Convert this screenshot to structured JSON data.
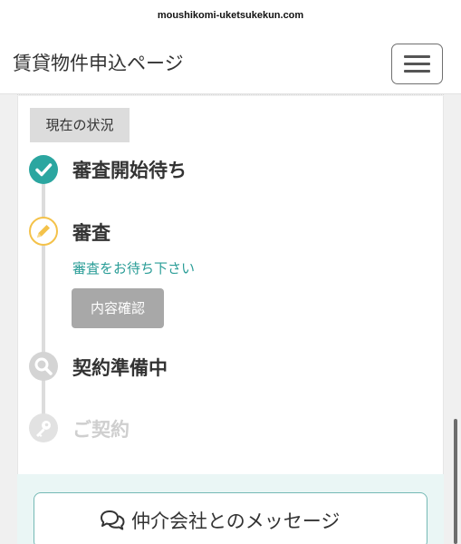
{
  "browser": {
    "url": "moushikomi-uketsukekun.com"
  },
  "header": {
    "title": "賃貸物件申込ページ"
  },
  "status": {
    "tag": "現在の状況"
  },
  "steps": [
    {
      "label": "審査開始待ち",
      "state": "done",
      "icon": "check-icon"
    },
    {
      "label": "審査",
      "state": "current",
      "icon": "pencil-icon",
      "note": "審査をお待ち下さい",
      "button": "内容確認"
    },
    {
      "label": "契約準備中",
      "state": "pending",
      "icon": "search-icon"
    },
    {
      "label": "ご契約",
      "state": "inactive",
      "icon": "key-icon"
    }
  ],
  "message": {
    "button_label": "仲介会社とのメッセージ",
    "icon": "chat-bubbles-icon"
  },
  "colors": {
    "accent": "#2ba6a0",
    "current": "#f4c24a",
    "button_gray": "#a8a8a8"
  }
}
